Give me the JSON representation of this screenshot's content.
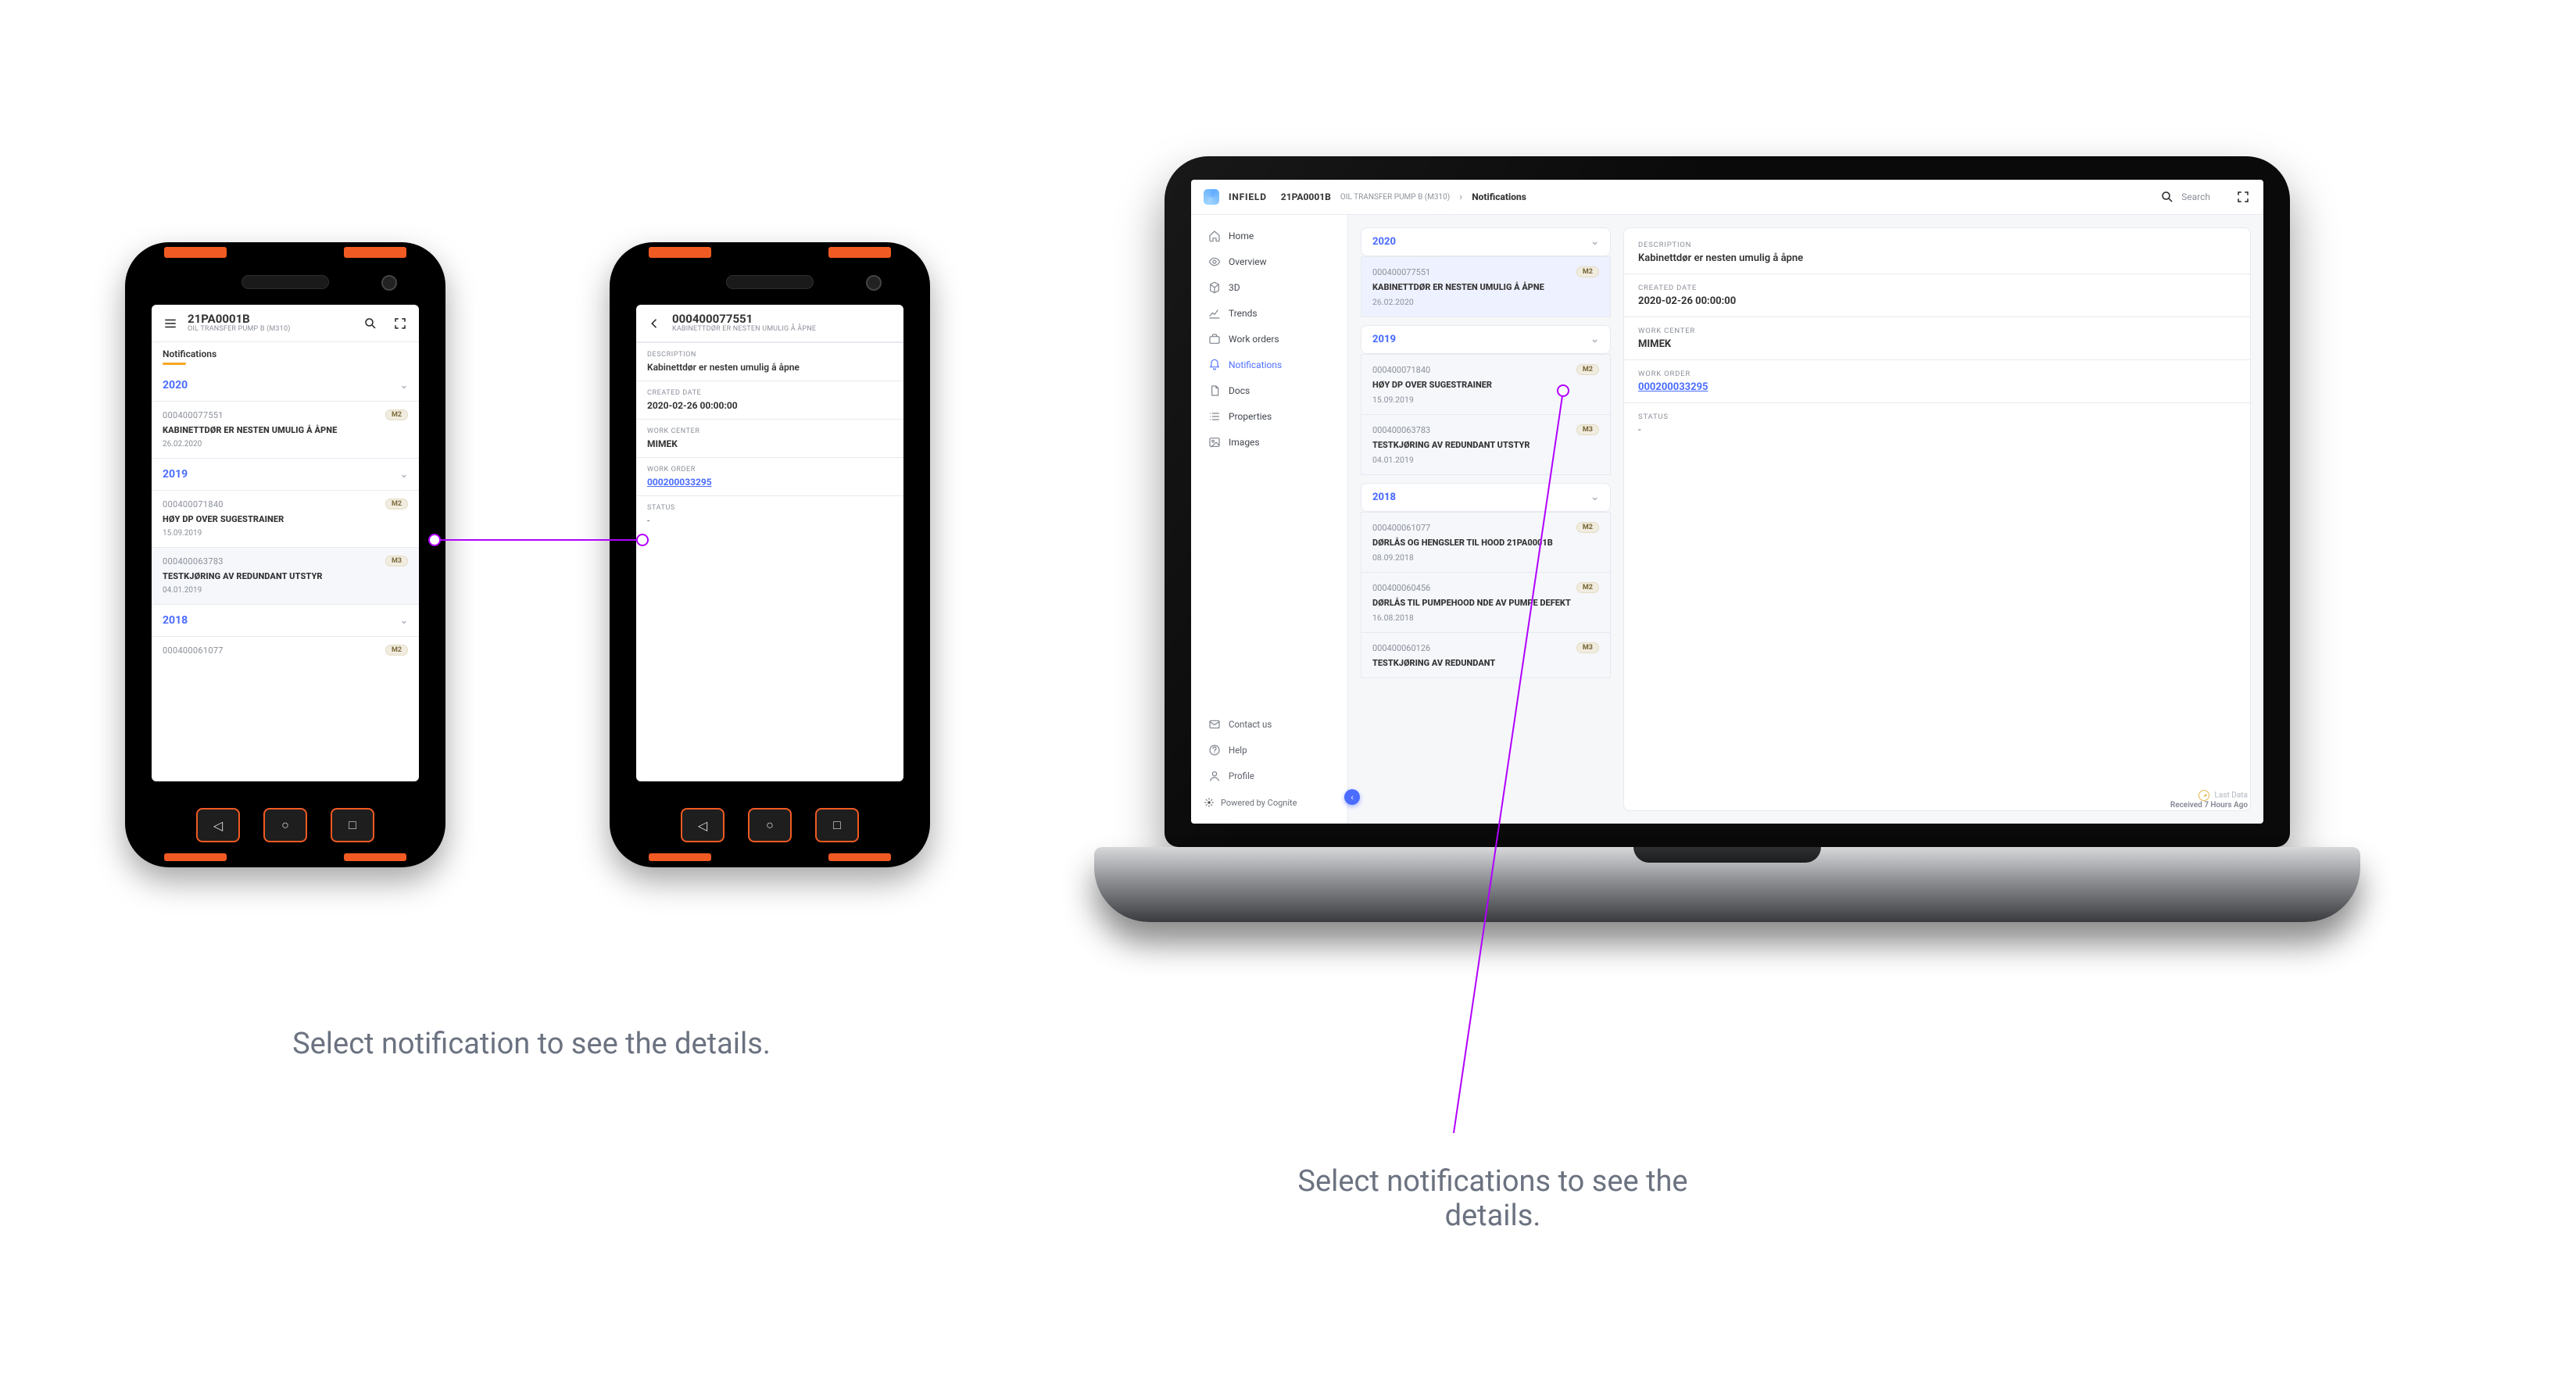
{
  "captions": {
    "mobile": "Select notification to see the details.",
    "desktop_l1": "Select notifications to see the",
    "desktop_l2": "details."
  },
  "app": {
    "brand": "INFIELD",
    "asset_id": "21PA0001B",
    "asset_sub": "OIL TRANSFER PUMP B (M310)",
    "page": "Notifications",
    "search_placeholder": "Search",
    "last_data_label": "Last Data",
    "last_data_value": "Received 7 Hours Ago",
    "powered_by": "Powered by Cognite"
  },
  "sidebar": {
    "items": [
      {
        "icon": "home",
        "label": "Home"
      },
      {
        "icon": "eye",
        "label": "Overview"
      },
      {
        "icon": "cube",
        "label": "3D"
      },
      {
        "icon": "trend",
        "label": "Trends"
      },
      {
        "icon": "briefcase",
        "label": "Work orders"
      },
      {
        "icon": "bell",
        "label": "Notifications"
      },
      {
        "icon": "doc",
        "label": "Docs"
      },
      {
        "icon": "list",
        "label": "Properties"
      },
      {
        "icon": "image",
        "label": "Images"
      }
    ],
    "footer": [
      {
        "icon": "mail",
        "label": "Contact us"
      },
      {
        "icon": "help",
        "label": "Help"
      },
      {
        "icon": "user",
        "label": "Profile"
      }
    ]
  },
  "list": {
    "years": [
      {
        "year": "2020",
        "items": [
          {
            "id": "000400077551",
            "badge": "M2",
            "title": "KABINETTDØR ER NESTEN UMULIG Å ÅPNE",
            "date": "26.02.2020",
            "selected": true
          }
        ]
      },
      {
        "year": "2019",
        "items": [
          {
            "id": "000400071840",
            "badge": "M2",
            "title": "HØY DP OVER SUGESTRAINER",
            "date": "15.09.2019"
          },
          {
            "id": "000400063783",
            "badge": "M3",
            "title": "TESTKJØRING AV REDUNDANT UTSTYR",
            "date": "04.01.2019"
          }
        ]
      },
      {
        "year": "2018",
        "items": [
          {
            "id": "000400061077",
            "badge": "M2",
            "title": "DØRLÅS OG HENGSLER TIL HOOD 21PA0001B",
            "date": "08.09.2018"
          },
          {
            "id": "000400060456",
            "badge": "M2",
            "title": "DØRLÅS TIL PUMPEHOOD NDE AV PUMPE DEFEKT",
            "date": "16.08.2018"
          },
          {
            "id": "000400060126",
            "badge": "M3",
            "title": "TESTKJØRING AV REDUNDANT",
            "date": ""
          }
        ]
      }
    ]
  },
  "detail": {
    "description_label": "DESCRIPTION",
    "description": "Kabinettdør er nesten umulig å åpne",
    "created_date_label": "CREATED DATE",
    "created_date": "2020-02-26 00:00:00",
    "work_center_label": "WORK CENTER",
    "work_center": "MIMEK",
    "work_order_label": "WORK ORDER",
    "work_order": "000200033295",
    "status_label": "STATUS",
    "status": "-"
  },
  "mobile_left": {
    "asset_id": "21PA0001B",
    "asset_sub": "OIL TRANSFER PUMP B (M310)",
    "tab": "Notifications",
    "years": [
      {
        "year": "2020",
        "items": [
          {
            "id": "000400077551",
            "badge": "M2",
            "title": "KABINETTDØR ER NESTEN UMULIG Å ÅPNE",
            "date": "26.02.2020"
          }
        ]
      },
      {
        "year": "2019",
        "items": [
          {
            "id": "000400071840",
            "badge": "M2",
            "title": "HØY DP OVER SUGESTRAINER",
            "date": "15.09.2019"
          },
          {
            "id": "000400063783",
            "badge": "M3",
            "title": "TESTKJØRING AV REDUNDANT UTSTYR",
            "date": "04.01.2019"
          }
        ]
      },
      {
        "year": "2018",
        "items": [
          {
            "id": "000400061077",
            "badge": "M2",
            "title": "",
            "date": ""
          }
        ]
      }
    ]
  },
  "mobile_right": {
    "header_id": "000400077551",
    "header_sub": "Kabinettdør er nesten umulig å åpne"
  }
}
